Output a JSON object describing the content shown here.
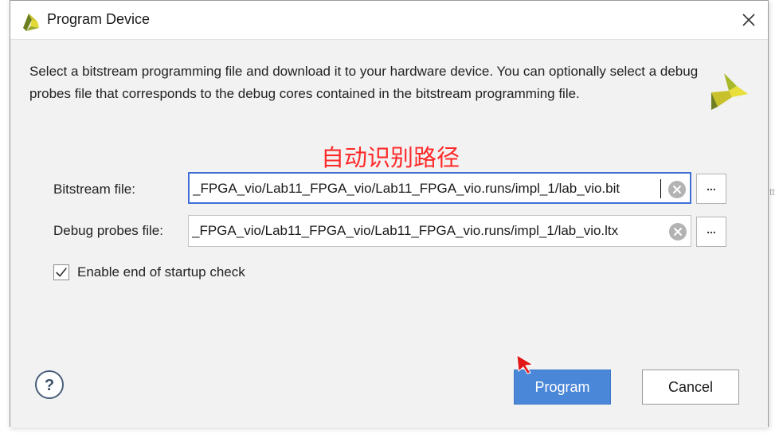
{
  "dialog": {
    "title": "Program Device",
    "description": "Select a bitstream programming file and download it to your hardware device. You can optionally select a debug probes file that corresponds to the debug cores contained in the bitstream programming file.",
    "annotation": "自动识别路径",
    "bitstream": {
      "label": "Bitstream file:",
      "value": "_FPGA_vio/Lab11_FPGA_vio/Lab11_FPGA_vio.runs/impl_1/lab_vio.bit"
    },
    "probes": {
      "label": "Debug probes file:",
      "value": "_FPGA_vio/Lab11_FPGA_vio/Lab11_FPGA_vio.runs/impl_1/lab_vio.ltx"
    },
    "browse_label": "...",
    "startup_check": {
      "label": "Enable end of startup check",
      "checked": true
    },
    "help_label": "?",
    "program_label": "Program",
    "cancel_label": "Cancel"
  },
  "background_text": "tt",
  "colors": {
    "accent": "#4b87d8",
    "focus_border": "#3f6fd6",
    "annotation": "#ff2a2a"
  },
  "icons": [
    "vivado-logo-icon",
    "close-icon",
    "xilinx-logo-icon",
    "clear-icon",
    "checkmark-icon",
    "help-icon",
    "cursor-arrow-icon"
  ]
}
